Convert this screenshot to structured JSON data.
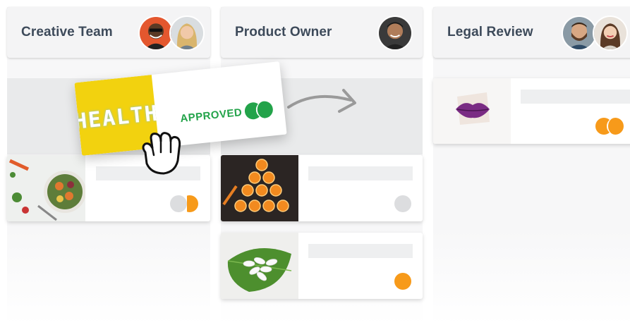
{
  "columns": [
    {
      "title": "Creative Team",
      "avatars": [
        "avatar-man-sunglasses",
        "avatar-woman-blonde"
      ]
    },
    {
      "title": "Product Owner",
      "avatars": [
        "avatar-man-smiling"
      ]
    },
    {
      "title": "Legal Review",
      "avatars": [
        "avatar-man-beard",
        "avatar-woman-brunette"
      ]
    }
  ],
  "dragged_card": {
    "thumbnail_text": "HEALTH",
    "status": "APPROVED",
    "status_color": "#23a34a"
  },
  "cards": [
    {
      "column": "Creative Team",
      "image": "salad-bowl",
      "indicator": "grey-orange"
    },
    {
      "column": "Product Owner",
      "image": "orange-slices-pyramid",
      "indicator": "grey"
    },
    {
      "column": "Product Owner",
      "image": "pills-on-leaf",
      "indicator": "orange"
    },
    {
      "column": "Legal Review",
      "image": "purple-lips",
      "indicator": "orange-orange"
    }
  ],
  "colors": {
    "accent_orange": "#f79a1a",
    "approved_green": "#23a34a",
    "indicator_grey": "#dcdddf",
    "header_text": "#3d4a5a"
  }
}
